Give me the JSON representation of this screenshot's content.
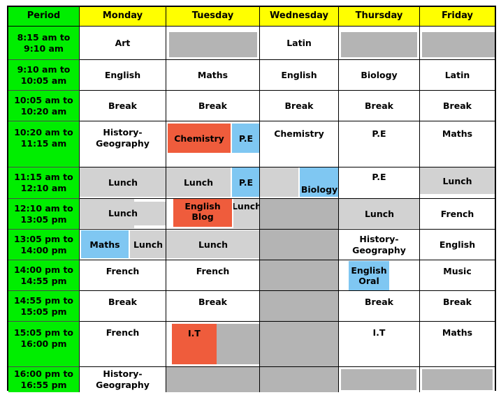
{
  "document": {
    "type": "school-timetable",
    "colors": {
      "period_header": "#00ee00",
      "day_header": "#ffff00",
      "free_gray": "#b4b4b4",
      "lunch_gray": "#d2d2d2",
      "highlight_blue": "#7fc7f2",
      "highlight_orange": "#ef5c3c",
      "grid_line": "#000000",
      "page_background": "#ffffff"
    }
  },
  "header": {
    "period_label": "Period",
    "days": [
      "Monday",
      "Tuesday",
      "Wednesday",
      "Thursday",
      "Friday"
    ]
  },
  "periods": [
    "8:15 am to 9:10 am",
    "9:10 am to 10:05 am",
    "10:05 am to 10:20 am",
    "10:20 am to 11:15 am",
    "11:15 am to 12:10 am",
    "12:10 am to 13:05 pm",
    "13:05 pm to 14:00 pm",
    "14:00 pm to 14:55 pm",
    "14:55 pm to 15:05 pm",
    "15:05 pm to 16:00 pm",
    "16:00 pm to 16:55 pm"
  ],
  "periods_lines": {
    "p0a": "8:15 am to",
    "p0b": "9:10 am",
    "p1a": "9:10 am to",
    "p1b": "10:05 am",
    "p2a": "10:05 am to",
    "p2b": "10:20 am",
    "p3a": "10:20 am to",
    "p3b": "11:15 am",
    "p4a": "11:15 am to",
    "p4b": "12:10 am",
    "p5a": "12:10 am to",
    "p5b": "13:05 pm",
    "p6a": "13:05 pm to",
    "p6b": "14:00 pm",
    "p7a": "14:00 pm to",
    "p7b": "14:55 pm",
    "p8a": "14:55 pm to",
    "p8b": "15:05 pm",
    "p9a": "15:05 pm to",
    "p9b": "16:00 pm",
    "p10a": "16:00 pm to",
    "p10b": "16:55 pm"
  },
  "schedule": {
    "r0": {
      "monday": "Art",
      "tuesday": "",
      "wednesday": "Latin",
      "thursday": "",
      "friday": ""
    },
    "r1": {
      "monday": "English",
      "tuesday": "Maths",
      "wednesday": "English",
      "thursday": "Biology",
      "friday": "Latin"
    },
    "r2": {
      "monday": "Break",
      "tuesday": "Break",
      "wednesday": "Break",
      "thursday": "Break",
      "friday": "Break"
    },
    "r3": {
      "monday_line1": "History-",
      "monday_line2": "Geography",
      "tuesday_a": "Chemistry",
      "tuesday_b": "P.E",
      "wednesday": "Chemistry",
      "thursday": "P.E",
      "friday": "Maths"
    },
    "r4": {
      "monday": "Lunch",
      "tuesday_a": "Lunch",
      "tuesday_b": "P.E",
      "wednesday_b": "Biology",
      "thursday": "P.E",
      "friday": "Lunch"
    },
    "r5": {
      "monday": "Lunch",
      "tuesday_a": "English Blog",
      "tuesday_b": "Lunch",
      "thursday": "Lunch",
      "friday": "French"
    },
    "r6": {
      "monday_a": "Maths",
      "monday_b": "Lunch",
      "tuesday": "Lunch",
      "thursday_line1": "History-",
      "thursday_line2": "Geography",
      "friday": "English"
    },
    "r7": {
      "monday": "French",
      "tuesday": "French",
      "thursday_line1": "English",
      "thursday_line2": "Oral",
      "friday": "Music"
    },
    "r8": {
      "monday": "Break",
      "tuesday": "Break",
      "thursday": "Break",
      "friday": "Break"
    },
    "r9": {
      "monday": "French",
      "tuesday_a": "I.T",
      "thursday": "I.T",
      "friday": "Maths"
    },
    "r10": {
      "monday_line1": "History-",
      "monday_line2": "Geography"
    }
  }
}
